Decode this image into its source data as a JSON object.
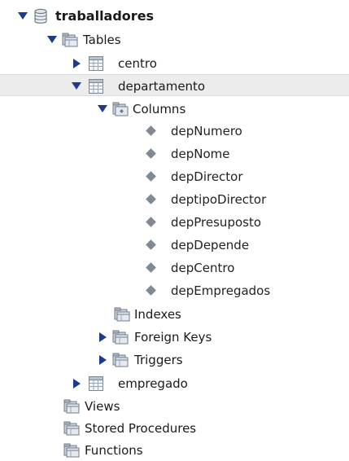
{
  "tree": {
    "schema": {
      "label": "traballadores",
      "icon": "database-icon",
      "expanded": true
    },
    "tables_folder": {
      "label": "Tables",
      "icon": "folder-table-icon",
      "expanded": true
    },
    "table_centro": {
      "label": "centro",
      "icon": "table-icon",
      "expanded": false
    },
    "table_departamento": {
      "label": "departamento",
      "icon": "table-icon",
      "expanded": true,
      "selected": true
    },
    "columns_folder": {
      "label": "Columns",
      "icon": "columns-folder-icon",
      "expanded": true
    },
    "columns": [
      {
        "label": "depNumero"
      },
      {
        "label": "depNome"
      },
      {
        "label": "depDirector"
      },
      {
        "label": "deptipoDirector"
      },
      {
        "label": "depPresuposto"
      },
      {
        "label": "depDepende"
      },
      {
        "label": "depCentro"
      },
      {
        "label": "depEmpregados"
      }
    ],
    "indexes_folder": {
      "label": "Indexes",
      "icon": "folder-icon"
    },
    "foreign_keys_folder": {
      "label": "Foreign Keys",
      "icon": "folder-icon",
      "expanded": false
    },
    "triggers_folder": {
      "label": "Triggers",
      "icon": "folder-icon",
      "expanded": false
    },
    "table_empregado": {
      "label": "empregado",
      "icon": "table-icon",
      "expanded": false
    },
    "views_folder": {
      "label": "Views",
      "icon": "folder-icon"
    },
    "procedures_folder": {
      "label": "Stored Procedures",
      "icon": "folder-icon"
    },
    "functions_folder": {
      "label": "Functions",
      "icon": "folder-icon"
    }
  },
  "colors": {
    "arrow": "#1e3a8a",
    "selected_row": "#ececec",
    "diamond": "#7f8a95",
    "icon_gray": "#8a96a3"
  }
}
